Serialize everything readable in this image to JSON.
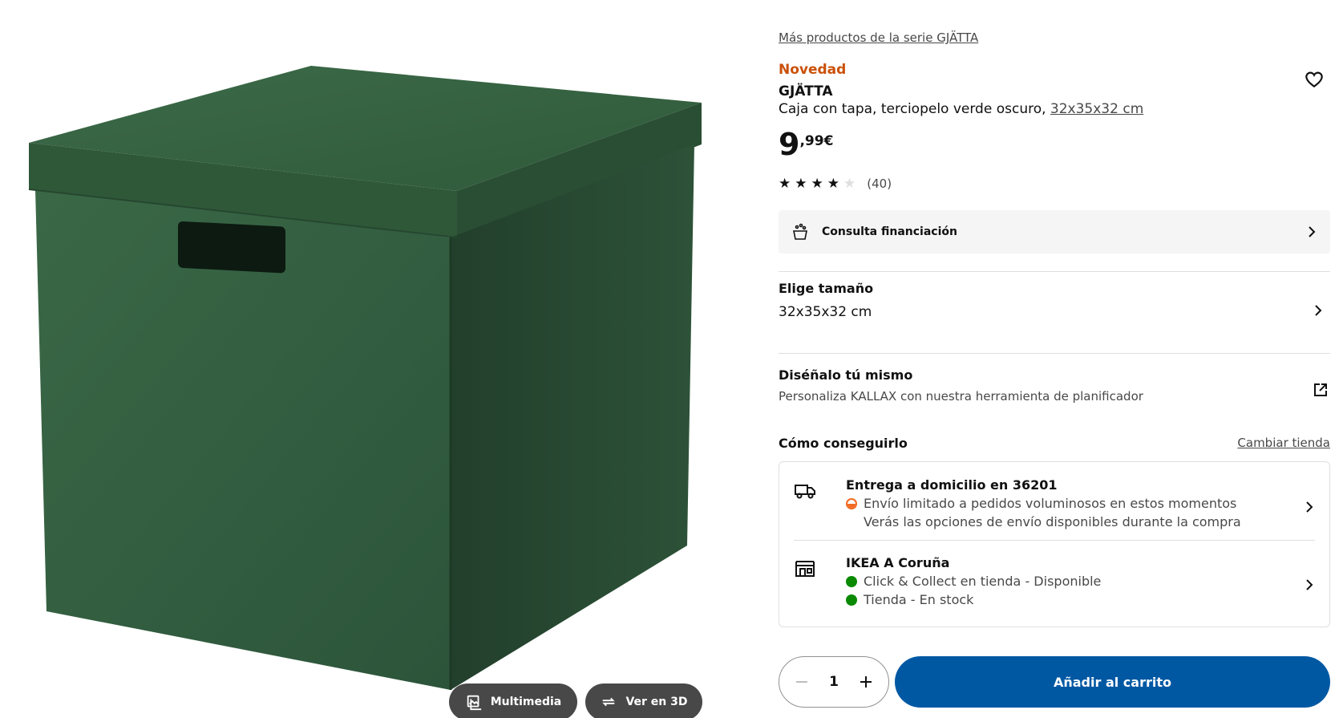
{
  "gallery": {
    "multimedia_label": "Multimedia",
    "view3d_label": "Ver en 3D",
    "product_color": "#2f5a3b"
  },
  "product": {
    "series_link": "Más productos de la serie GJÄTTA",
    "badge": "Novedad",
    "name": "GJÄTTA",
    "description": "Caja con tapa, terciopelo verde oscuro, ",
    "size_link": "32x35x32 cm",
    "price_int": "9",
    "price_dec": ",99€",
    "rating": 4,
    "rating_max": 5,
    "rating_count": "(40)"
  },
  "finance": {
    "label": "Consulta financiación"
  },
  "size": {
    "title": "Elige tamaño",
    "value": "32x35x32 cm"
  },
  "design": {
    "title": "Diséñalo tú mismo",
    "subtitle": "Personaliza KALLAX con nuestra herramienta de planificador"
  },
  "availability": {
    "title": "Cómo conseguirlo",
    "change_store": "Cambiar tienda",
    "delivery": {
      "title": "Entrega a domicilio en 36201",
      "line1": "Envío limitado a pedidos voluminosos en estos momentos",
      "line2": "Verás las opciones de envío disponibles durante la compra"
    },
    "store": {
      "title": "IKEA A Coruña",
      "line1": "Click & Collect en tienda - Disponible",
      "line2": "Tienda - En stock"
    }
  },
  "cart": {
    "quantity": "1",
    "add_label": "Añadir al carrito"
  },
  "colors": {
    "accent_blue": "#0058a3",
    "badge_orange": "#ca5008",
    "in_stock_green": "#0a8a00",
    "limited_orange": "#f26a20"
  }
}
